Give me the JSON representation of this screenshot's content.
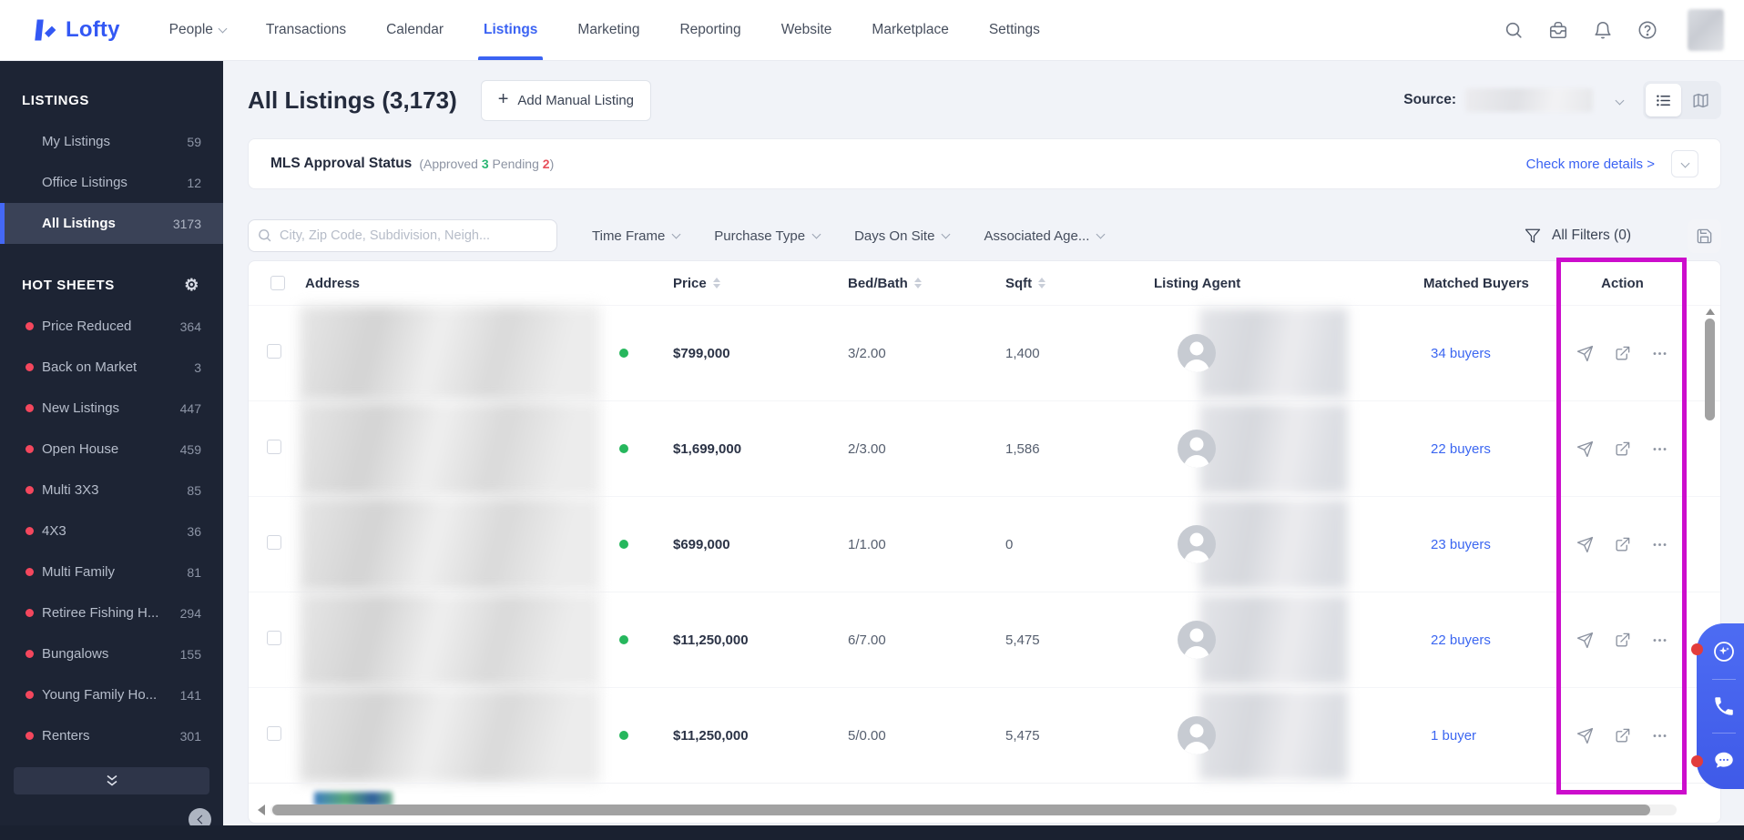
{
  "navbar": {
    "brand": "Lofty",
    "items": [
      "People",
      "Transactions",
      "Calendar",
      "Listings",
      "Marketing",
      "Reporting",
      "Website",
      "Marketplace",
      "Settings"
    ]
  },
  "sidebar": {
    "listings": {
      "header": "LISTINGS",
      "items": [
        {
          "label": "My Listings",
          "count": "59"
        },
        {
          "label": "Office Listings",
          "count": "12"
        },
        {
          "label": "All Listings",
          "count": "3173"
        }
      ]
    },
    "hot_sheets": {
      "header": "HOT SHEETS",
      "items": [
        {
          "label": "Price Reduced",
          "count": "364"
        },
        {
          "label": "Back on Market",
          "count": "3"
        },
        {
          "label": "New Listings",
          "count": "447"
        },
        {
          "label": "Open House",
          "count": "459"
        },
        {
          "label": "Multi 3X3",
          "count": "85"
        },
        {
          "label": "4X3",
          "count": "36"
        },
        {
          "label": "Multi Family",
          "count": "81"
        },
        {
          "label": "Retiree Fishing H...",
          "count": "294"
        },
        {
          "label": "Bungalows",
          "count": "155"
        },
        {
          "label": "Young Family Ho...",
          "count": "141"
        },
        {
          "label": "Renters",
          "count": "301"
        }
      ]
    }
  },
  "page_header": {
    "title": "All Listings (3,173)",
    "add_listing_button": "Add Manual Listing",
    "source_label": "Source:"
  },
  "mls_status": {
    "title": "MLS Approval Status",
    "open_paren": "(",
    "approved_label": "Approved",
    "approved_count": "3",
    "pending_label": "Pending",
    "pending_count": "2",
    "close_paren": ")",
    "details_link": "Check more details >"
  },
  "filters": {
    "search_placeholder": "City, Zip Code, Subdivision, Neigh...",
    "time_frame": "Time Frame",
    "purchase_type": "Purchase Type",
    "days_on_site": "Days On Site",
    "associated_agent": "Associated Age...",
    "all_filters": "All Filters (0)"
  },
  "table": {
    "columns": {
      "address": "Address",
      "price": "Price",
      "bed_bath": "Bed/Bath",
      "sqft": "Sqft",
      "listing_agent": "Listing Agent",
      "matched_buyers": "Matched Buyers",
      "action": "Action"
    },
    "rows": [
      {
        "price": "$799,000",
        "bed_bath": "3/2.00",
        "sqft": "1,400",
        "matched_buyers": "34 buyers"
      },
      {
        "price": "$1,699,000",
        "bed_bath": "2/3.00",
        "sqft": "1,586",
        "matched_buyers": "22 buyers"
      },
      {
        "price": "$699,000",
        "bed_bath": "1/1.00",
        "sqft": "0",
        "matched_buyers": "23 buyers"
      },
      {
        "price": "$11,250,000",
        "bed_bath": "6/7.00",
        "sqft": "5,475",
        "matched_buyers": "22 buyers"
      },
      {
        "price": "$11,250,000",
        "bed_bath": "5/0.00",
        "sqft": "5,475",
        "matched_buyers": "1 buyer"
      }
    ]
  },
  "colors": {
    "accent_blue": "#3b63f3",
    "highlight_magenta": "#cc0dcc",
    "status_green": "#26b75d",
    "hot_sheet_red": "#f4475d",
    "approved_green": "#2bb673",
    "pending_red": "#e8505b",
    "sidebar_bg": "#1d2434"
  }
}
